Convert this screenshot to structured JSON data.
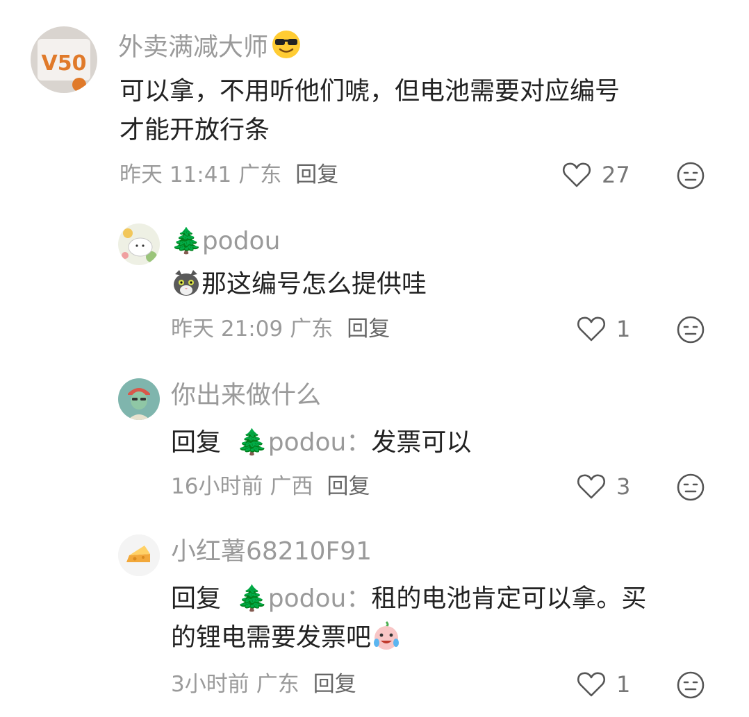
{
  "comments": [
    {
      "author": "外卖满减大师",
      "author_emoji": "sunglasses-face",
      "text_lines": [
        "可以拿，不用听他们唬，但电池需要对应编号",
        "才能开放行条"
      ],
      "time": "昨天 11:41",
      "location": "广东",
      "reply_label": "回复",
      "likes": "27"
    },
    {
      "author": "🌲podou",
      "text_lines": [
        "那这编号怎么提供哇"
      ],
      "lead_emoji": "cat-face",
      "time": "昨天 21:09",
      "location": "广东",
      "reply_label": "回复",
      "likes": "1"
    },
    {
      "author": "你出来做什么",
      "reply_prefix": "回复",
      "mention": "🌲podou：",
      "text_lines": [
        "发票可以"
      ],
      "time": "16小时前",
      "location": "广西",
      "reply_label": "回复",
      "likes": "3"
    },
    {
      "author": "小红薯68210F91",
      "reply_prefix": "回复",
      "mention": "🌲podou：",
      "text_lines": [
        "租的电池肯定可以拿。买",
        "的锂电需要发票吧"
      ],
      "trail_emoji": "crying-laughing-face",
      "time": "3小时前",
      "location": "广东",
      "reply_label": "回复",
      "likes": "1"
    }
  ],
  "colors": {
    "primary_text": "#222222",
    "secondary_text": "#9a9a9a",
    "icon_stroke": "#555555"
  }
}
